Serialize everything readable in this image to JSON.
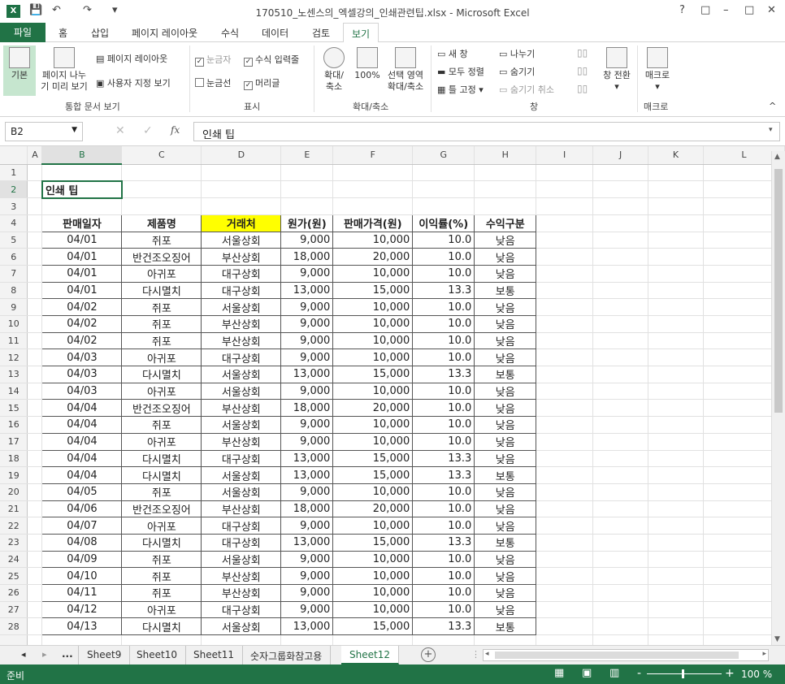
{
  "window": {
    "app_icon": "X",
    "title": "170510_노센스의_엑셀강의_인쇄관련팁.xlsx - Microsoft Excel",
    "help": "?",
    "ribbon_display": "□",
    "minimize": "–",
    "maximize": "□",
    "close": "✕"
  },
  "quick_access": {
    "save": "💾",
    "undo": "↶",
    "redo": "↷",
    "customize": "▾"
  },
  "ribbon_tabs": [
    "파일",
    "홈",
    "삽입",
    "페이지 레이아웃",
    "수식",
    "데이터",
    "검토",
    "보기"
  ],
  "ribbon": {
    "workbook_views": {
      "label": "통합 문서 보기",
      "normal": "기본",
      "page_break_1": "페이지 나누",
      "page_break_2": "기 미리 보기",
      "page_layout": "페이지 레이아웃",
      "custom_views": "사용자 지정 보기"
    },
    "show": {
      "label": "표시",
      "ruler": "눈금자",
      "formula_bar": "수식 입력줄",
      "gridlines": "눈금선",
      "headings": "머리글"
    },
    "zoom": {
      "label": "확대/축소",
      "zoom_1": "확대/",
      "zoom_2": "축소",
      "hundred": "100%",
      "selection_1": "선택 영역",
      "selection_2": "확대/축소"
    },
    "window": {
      "label": "창",
      "new_window": "새 창",
      "arrange_all": "모두 정렬",
      "freeze": "틀 고정",
      "split": "나누기",
      "hide": "숨기기",
      "unhide": "숨기기 취소",
      "switch": "창 전환"
    },
    "macros": {
      "label": "매크로",
      "macro": "매크로"
    }
  },
  "formula_bar": {
    "cell_ref": "B2",
    "cancel": "✕",
    "enter": "✓",
    "fx": "fx",
    "content": "인쇄 팁"
  },
  "columns": [
    "A",
    "B",
    "C",
    "D",
    "E",
    "F",
    "G",
    "H",
    "I",
    "J",
    "K",
    "L"
  ],
  "sheet": {
    "title": "인쇄 팁",
    "headers": [
      "판매일자",
      "제품명",
      "거래처",
      "원가(원)",
      "판매가격(원)",
      "이익률(%)",
      "수익구분"
    ],
    "rows": [
      [
        "04/01",
        "쥐포",
        "서울상회",
        "9,000",
        "10,000",
        "10.0",
        "낮음"
      ],
      [
        "04/01",
        "반건조오징어",
        "부산상회",
        "18,000",
        "20,000",
        "10.0",
        "낮음"
      ],
      [
        "04/01",
        "아귀포",
        "대구상회",
        "9,000",
        "10,000",
        "10.0",
        "낮음"
      ],
      [
        "04/01",
        "다시멸치",
        "대구상회",
        "13,000",
        "15,000",
        "13.3",
        "보통"
      ],
      [
        "04/02",
        "쥐포",
        "서울상회",
        "9,000",
        "10,000",
        "10.0",
        "낮음"
      ],
      [
        "04/02",
        "쥐포",
        "부산상회",
        "9,000",
        "10,000",
        "10.0",
        "낮음"
      ],
      [
        "04/02",
        "쥐포",
        "부산상회",
        "9,000",
        "10,000",
        "10.0",
        "낮음"
      ],
      [
        "04/03",
        "아귀포",
        "대구상회",
        "9,000",
        "10,000",
        "10.0",
        "낮음"
      ],
      [
        "04/03",
        "다시멸치",
        "서울상회",
        "13,000",
        "15,000",
        "13.3",
        "보통"
      ],
      [
        "04/03",
        "아귀포",
        "서울상회",
        "9,000",
        "10,000",
        "10.0",
        "낮음"
      ],
      [
        "04/04",
        "반건조오징어",
        "부산상회",
        "18,000",
        "20,000",
        "10.0",
        "낮음"
      ],
      [
        "04/04",
        "쥐포",
        "서울상회",
        "9,000",
        "10,000",
        "10.0",
        "낮음"
      ],
      [
        "04/04",
        "아귀포",
        "부산상회",
        "9,000",
        "10,000",
        "10.0",
        "낮음"
      ],
      [
        "04/04",
        "다시멸치",
        "대구상회",
        "13,000",
        "15,000",
        "13.3",
        "낮음"
      ],
      [
        "04/04",
        "다시멸치",
        "서울상회",
        "13,000",
        "15,000",
        "13.3",
        "보통"
      ],
      [
        "04/05",
        "쥐포",
        "서울상회",
        "9,000",
        "10,000",
        "10.0",
        "낮음"
      ],
      [
        "04/06",
        "반건조오징어",
        "부산상회",
        "18,000",
        "20,000",
        "10.0",
        "낮음"
      ],
      [
        "04/07",
        "아귀포",
        "대구상회",
        "9,000",
        "10,000",
        "10.0",
        "낮음"
      ],
      [
        "04/08",
        "다시멸치",
        "대구상회",
        "13,000",
        "15,000",
        "13.3",
        "보통"
      ],
      [
        "04/09",
        "쥐포",
        "서울상회",
        "9,000",
        "10,000",
        "10.0",
        "낮음"
      ],
      [
        "04/10",
        "쥐포",
        "부산상회",
        "9,000",
        "10,000",
        "10.0",
        "낮음"
      ],
      [
        "04/11",
        "쥐포",
        "부산상회",
        "9,000",
        "10,000",
        "10.0",
        "낮음"
      ],
      [
        "04/12",
        "아귀포",
        "대구상회",
        "9,000",
        "10,000",
        "10.0",
        "낮음"
      ],
      [
        "04/13",
        "다시멸치",
        "서울상회",
        "13,000",
        "15,000",
        "13.3",
        "보통"
      ]
    ]
  },
  "sheet_tabs": {
    "first": "◂",
    "next": "▸",
    "more": "...",
    "tabs": [
      "Sheet9",
      "Sheet10",
      "Sheet11",
      "숫자그룹화참고용",
      "Sheet12"
    ],
    "active": "Sheet12",
    "add": "+"
  },
  "status": {
    "ready": "준비",
    "zoom_minus": "-",
    "zoom_plus": "+",
    "zoom": "100 %"
  },
  "colors": {
    "accent": "#217346",
    "header_highlight": "#ffff00"
  }
}
